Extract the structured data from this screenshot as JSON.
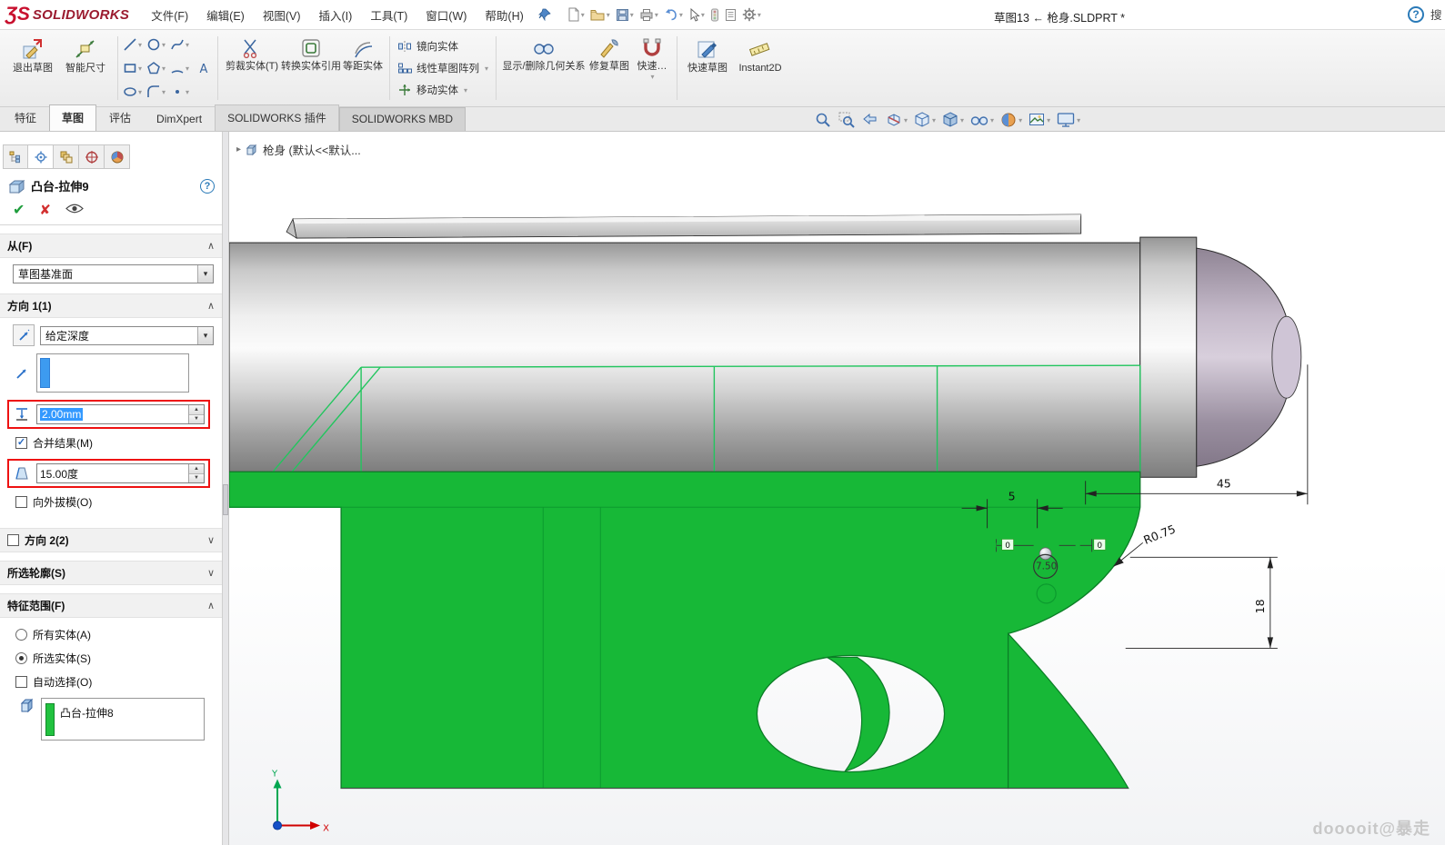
{
  "icons": {
    "dropdown_arrow": "▾",
    "section_collapse": "∧",
    "section_expand": "∨",
    "ok_check": "✔",
    "cancel_cross": "✘",
    "breadcrumb_arrow": "▸",
    "spinner_up": "▲",
    "spinner_down": "▼",
    "checkbox_check": "✓",
    "help": "?"
  },
  "titlebar": {
    "logo_glyph": "ƷS",
    "logo_text": "SOLIDWORKS",
    "menus": [
      "文件(F)",
      "编辑(E)",
      "视图(V)",
      "插入(I)",
      "工具(T)",
      "窗口(W)",
      "帮助(H)"
    ],
    "document_title": "草图13 ← 枪身.SLDPRT *",
    "search_hint": "搜"
  },
  "quick_access_tools": [
    "new",
    "open",
    "save",
    "print",
    "undo",
    "select",
    "rebuild",
    "file-properties",
    "options"
  ],
  "ribbon": {
    "exit_sketch": "退出草图",
    "smart_dimension": "智能尺寸",
    "trim_entities": "剪裁实体(T)",
    "convert_entities": "转换实体引用",
    "offset_entities": "等距实体",
    "mirror_entities": "镜向实体",
    "linear_sketch_pattern": "线性草图阵列",
    "move_entities": "移动实体",
    "display_delete_relations": "显示/删除几何关系",
    "repair_sketch": "修复草图",
    "quick_snaps": "快速…",
    "rapid_sketch": "快速草图",
    "instant2d": "Instant2D"
  },
  "tabs": {
    "items": [
      "特征",
      "草图",
      "评估",
      "DimXpert",
      "SOLIDWORKS 插件",
      "SOLIDWORKS MBD"
    ],
    "active": "草图"
  },
  "headsup_tools": [
    "zoom-to-fit",
    "zoom-to-area",
    "previous-view",
    "section-view",
    "view-orientation",
    "display-style",
    "hide-show-items",
    "edit-appearance",
    "apply-scene",
    "view-settings"
  ],
  "property_manager": {
    "title": "凸台-拉伸9",
    "help": "?",
    "from": {
      "label": "从(F)",
      "value": "草图基准面"
    },
    "direction1": {
      "label": "方向 1(1)",
      "end_condition": "给定深度",
      "depth": "2.00mm",
      "merge_result": "合并结果(M)",
      "draft_angle": "15.00度",
      "draft_outward": "向外拔模(O)"
    },
    "direction2": {
      "label": "方向 2(2)"
    },
    "selected_contours": {
      "label": "所选轮廓(S)"
    },
    "feature_scope": {
      "label": "特征范围(F)",
      "all_bodies": "所有实体(A)",
      "selected_bodies": "所选实体(S)",
      "auto_select": "自动选择(O)",
      "body_item": "凸台-拉伸8"
    }
  },
  "viewport": {
    "breadcrumb": "枪身 (默认<<默认...",
    "dimensions": {
      "d45": "45",
      "d5": "5",
      "r075": "R0.75",
      "d18": "18",
      "d750": "7.50",
      "zero_a": "0",
      "zero_b": "0"
    },
    "axes": {
      "x": "X",
      "y": "Y"
    },
    "watermark": "dooooit@暴走"
  },
  "colors": {
    "highlight_green": "#17b837",
    "selection_blue": "#3399ff",
    "annotation_red": "#ee1111",
    "brand_red": "#c8102e",
    "cap_purple": "#b3a6ba"
  }
}
